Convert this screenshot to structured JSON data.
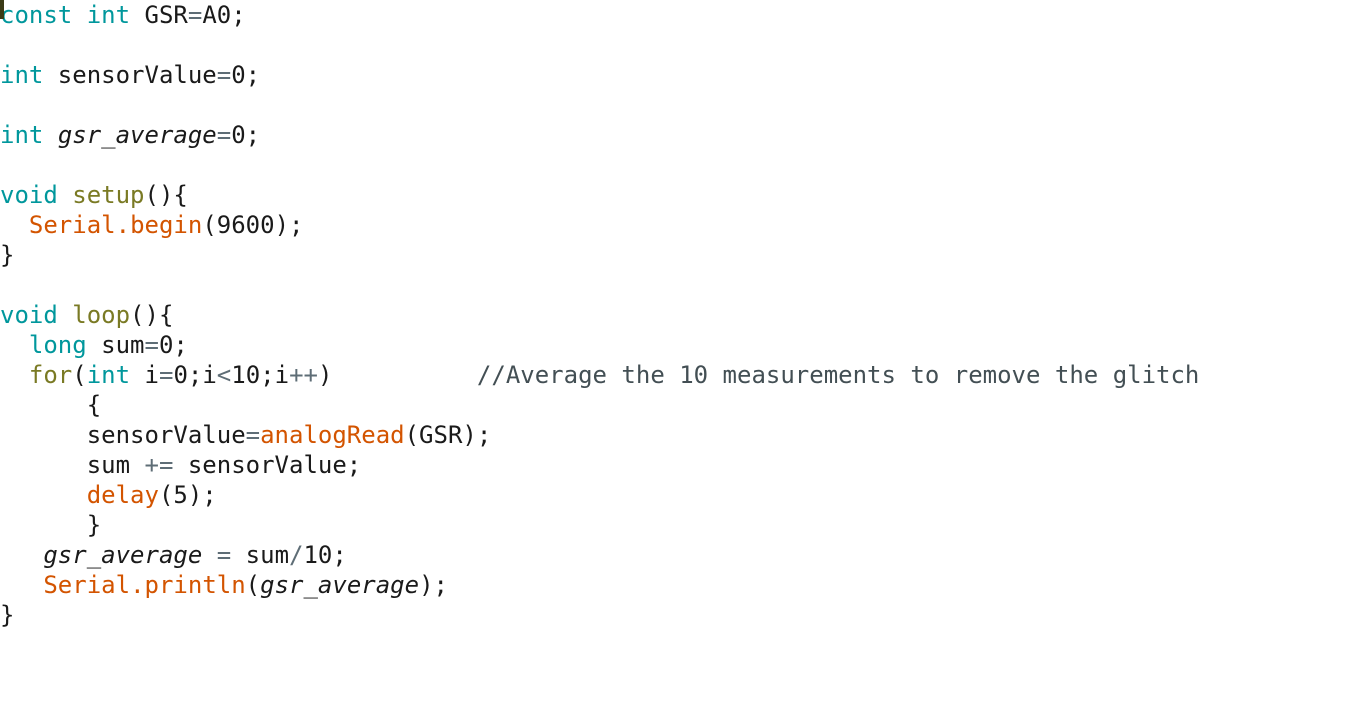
{
  "editor": {
    "background_color": "#ffffff",
    "font_size_px": 24,
    "line_height_px": 30,
    "caret": {
      "name": "text-caret",
      "line": 1,
      "column": 0,
      "color": "#3B3B16"
    }
  },
  "theme": {
    "keyword_color": "#00979C",
    "function_color": "#7A7A24",
    "library_color": "#D35400",
    "comment_color": "#434F54",
    "operator_color": "#5E6D76",
    "plain_color": "#1A1A1A"
  },
  "code": {
    "language": "arduino-c",
    "full_text": "const int GSR=A0;\n\nint sensorValue=0;\n\nint gsr_average=0;\n\nvoid setup(){\n  Serial.begin(9600);\n}\n\nvoid loop(){\n  long sum=0;\n  for(int i=0;i<10;i++)          //Average the 10 measurements to remove the glitch\n      {\n      sensorValue=analogRead(GSR);\n      sum += sensorValue;\n      delay(5);\n      }\n   gsr_average = sum/10;\n   Serial.println(gsr_average);\n}",
    "lines": [
      {
        "number": 1,
        "tokens": [
          {
            "t": "const",
            "k": "keyword"
          },
          {
            "t": " ",
            "k": "plain"
          },
          {
            "t": "int",
            "k": "keyword"
          },
          {
            "t": " GSR",
            "k": "plain"
          },
          {
            "t": "=",
            "k": "operator"
          },
          {
            "t": "A0",
            "k": "plain"
          },
          {
            "t": ";",
            "k": "punct"
          }
        ]
      },
      {
        "number": 2,
        "tokens": []
      },
      {
        "number": 3,
        "tokens": [
          {
            "t": "int",
            "k": "keyword"
          },
          {
            "t": " sensorValue",
            "k": "plain"
          },
          {
            "t": "=",
            "k": "operator"
          },
          {
            "t": "0",
            "k": "number"
          },
          {
            "t": ";",
            "k": "punct"
          }
        ]
      },
      {
        "number": 4,
        "tokens": []
      },
      {
        "number": 5,
        "tokens": [
          {
            "t": "int",
            "k": "keyword"
          },
          {
            "t": " ",
            "k": "plain"
          },
          {
            "t": "gsr_average",
            "k": "global"
          },
          {
            "t": "=",
            "k": "operator"
          },
          {
            "t": "0",
            "k": "number"
          },
          {
            "t": ";",
            "k": "punct"
          }
        ]
      },
      {
        "number": 6,
        "tokens": []
      },
      {
        "number": 7,
        "tokens": [
          {
            "t": "void",
            "k": "keyword"
          },
          {
            "t": " ",
            "k": "plain"
          },
          {
            "t": "setup",
            "k": "function"
          },
          {
            "t": "(){",
            "k": "punct"
          }
        ]
      },
      {
        "number": 8,
        "tokens": [
          {
            "t": "  ",
            "k": "plain"
          },
          {
            "t": "Serial",
            "k": "library"
          },
          {
            "t": ".",
            "k": "library"
          },
          {
            "t": "begin",
            "k": "library"
          },
          {
            "t": "(",
            "k": "punct"
          },
          {
            "t": "9600",
            "k": "number"
          },
          {
            "t": ");",
            "k": "punct"
          }
        ]
      },
      {
        "number": 9,
        "tokens": [
          {
            "t": "}",
            "k": "punct"
          }
        ]
      },
      {
        "number": 10,
        "tokens": []
      },
      {
        "number": 11,
        "tokens": [
          {
            "t": "void",
            "k": "keyword"
          },
          {
            "t": " ",
            "k": "plain"
          },
          {
            "t": "loop",
            "k": "function"
          },
          {
            "t": "(){",
            "k": "punct"
          }
        ]
      },
      {
        "number": 12,
        "tokens": [
          {
            "t": "  ",
            "k": "plain"
          },
          {
            "t": "long",
            "k": "keyword"
          },
          {
            "t": " sum",
            "k": "plain"
          },
          {
            "t": "=",
            "k": "operator"
          },
          {
            "t": "0",
            "k": "number"
          },
          {
            "t": ";",
            "k": "punct"
          }
        ]
      },
      {
        "number": 13,
        "tokens": [
          {
            "t": "  ",
            "k": "plain"
          },
          {
            "t": "for",
            "k": "function"
          },
          {
            "t": "(",
            "k": "punct"
          },
          {
            "t": "int",
            "k": "keyword"
          },
          {
            "t": " i",
            "k": "plain"
          },
          {
            "t": "=",
            "k": "operator"
          },
          {
            "t": "0",
            "k": "number"
          },
          {
            "t": ";",
            "k": "punct"
          },
          {
            "t": "i",
            "k": "plain"
          },
          {
            "t": "<",
            "k": "operator"
          },
          {
            "t": "10",
            "k": "number"
          },
          {
            "t": ";",
            "k": "punct"
          },
          {
            "t": "i",
            "k": "plain"
          },
          {
            "t": "++",
            "k": "operator"
          },
          {
            "t": ")",
            "k": "punct"
          },
          {
            "t": "          ",
            "k": "plain"
          },
          {
            "t": "//Average the 10 measurements to remove the glitch",
            "k": "comment"
          }
        ]
      },
      {
        "number": 14,
        "tokens": [
          {
            "t": "      ",
            "k": "plain"
          },
          {
            "t": "{",
            "k": "punct"
          }
        ]
      },
      {
        "number": 15,
        "tokens": [
          {
            "t": "      sensorValue",
            "k": "plain"
          },
          {
            "t": "=",
            "k": "operator"
          },
          {
            "t": "analogRead",
            "k": "library"
          },
          {
            "t": "(GSR);",
            "k": "punct"
          }
        ]
      },
      {
        "number": 16,
        "tokens": [
          {
            "t": "      sum ",
            "k": "plain"
          },
          {
            "t": "+=",
            "k": "operator"
          },
          {
            "t": " sensorValue",
            "k": "plain"
          },
          {
            "t": ";",
            "k": "punct"
          }
        ]
      },
      {
        "number": 17,
        "tokens": [
          {
            "t": "      ",
            "k": "plain"
          },
          {
            "t": "delay",
            "k": "library"
          },
          {
            "t": "(",
            "k": "punct"
          },
          {
            "t": "5",
            "k": "number"
          },
          {
            "t": ");",
            "k": "punct"
          }
        ]
      },
      {
        "number": 18,
        "tokens": [
          {
            "t": "      ",
            "k": "plain"
          },
          {
            "t": "}",
            "k": "punct"
          }
        ]
      },
      {
        "number": 19,
        "tokens": [
          {
            "t": "   ",
            "k": "plain"
          },
          {
            "t": "gsr_average",
            "k": "global"
          },
          {
            "t": " ",
            "k": "plain"
          },
          {
            "t": "=",
            "k": "operator"
          },
          {
            "t": " sum",
            "k": "plain"
          },
          {
            "t": "/",
            "k": "operator"
          },
          {
            "t": "10",
            "k": "number"
          },
          {
            "t": ";",
            "k": "punct"
          }
        ]
      },
      {
        "number": 20,
        "tokens": [
          {
            "t": "   ",
            "k": "plain"
          },
          {
            "t": "Serial",
            "k": "library"
          },
          {
            "t": ".",
            "k": "library"
          },
          {
            "t": "println",
            "k": "library"
          },
          {
            "t": "(",
            "k": "punct"
          },
          {
            "t": "gsr_average",
            "k": "global"
          },
          {
            "t": ");",
            "k": "punct"
          }
        ]
      },
      {
        "number": 21,
        "tokens": [
          {
            "t": "}",
            "k": "punct"
          }
        ]
      }
    ]
  }
}
